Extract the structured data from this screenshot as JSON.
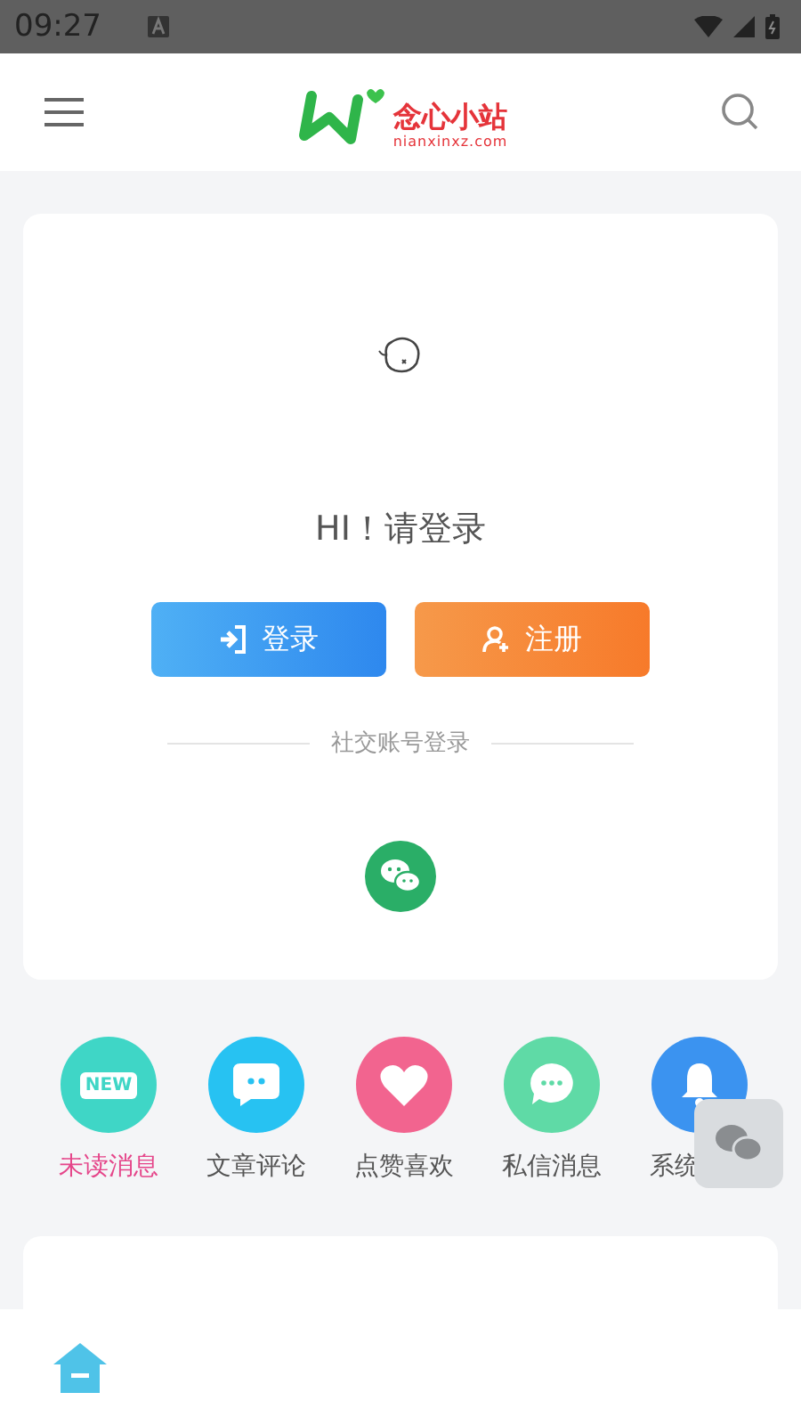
{
  "status_bar": {
    "time": "09:27"
  },
  "header": {
    "brand": "念心小站",
    "domain": "nianxinxz.com"
  },
  "login_card": {
    "greeting": "HI！请登录",
    "buttons": [
      {
        "kind": "login",
        "label": "登录"
      },
      {
        "kind": "register",
        "label": "注册"
      }
    ],
    "social_heading": "社交账号登录"
  },
  "shortcuts": [
    {
      "kind": "new",
      "label": "未读消息",
      "badge": "NEW",
      "selected": true
    },
    {
      "kind": "comment",
      "label": "文章评论",
      "selected": false
    },
    {
      "kind": "like",
      "label": "点赞喜欢",
      "selected": false
    },
    {
      "kind": "chat",
      "label": "私信消息",
      "selected": false
    },
    {
      "kind": "bell",
      "label": "系统",
      "selected": false
    }
  ],
  "bottom_nav": [
    {
      "kind": "home",
      "selected": true
    }
  ]
}
